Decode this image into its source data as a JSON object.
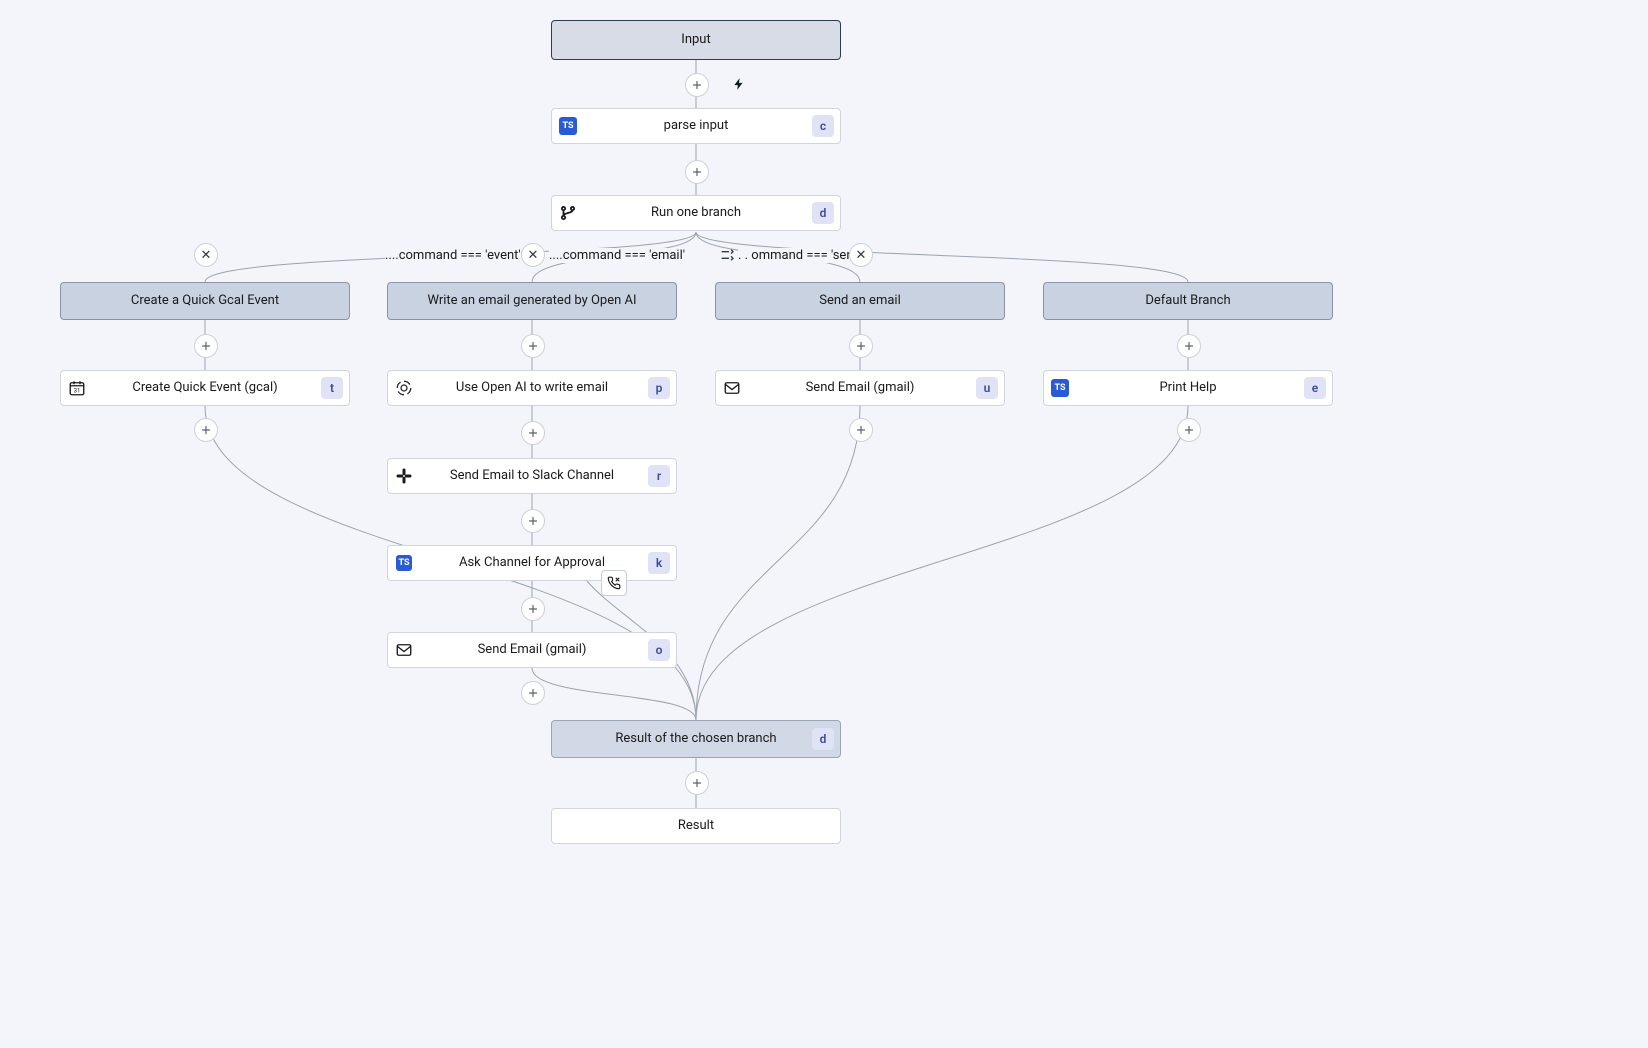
{
  "input": {
    "label": "Input"
  },
  "parseInput": {
    "label": "parse input",
    "key": "c"
  },
  "runBranch": {
    "label": "Run one branch",
    "key": "d"
  },
  "conds": {
    "event": "....command === 'event'",
    "email": "....command === 'email'",
    "send": ". .   ommand === 'send'"
  },
  "branches": {
    "gcal": {
      "head": "Create a Quick Gcal Event"
    },
    "openai": {
      "head": "Write an email generated by Open AI"
    },
    "send": {
      "head": "Send an email"
    },
    "default": {
      "head": "Default Branch"
    }
  },
  "steps": {
    "createQuick": {
      "label": "Create Quick Event (gcal)",
      "key": "t"
    },
    "useOpenAI": {
      "label": "Use Open AI to write email",
      "key": "p"
    },
    "sendSlack": {
      "label": "Send Email to Slack Channel",
      "key": "r"
    },
    "askApproval": {
      "label": "Ask Channel for Approval",
      "key": "k"
    },
    "sendGmail2": {
      "label": "Send Email (gmail)",
      "key": "o"
    },
    "sendGmail1": {
      "label": "Send Email (gmail)",
      "key": "u"
    },
    "printHelp": {
      "label": "Print Help",
      "key": "e"
    }
  },
  "resultBranch": {
    "label": "Result of the chosen branch",
    "key": "d"
  },
  "result": {
    "label": "Result"
  }
}
